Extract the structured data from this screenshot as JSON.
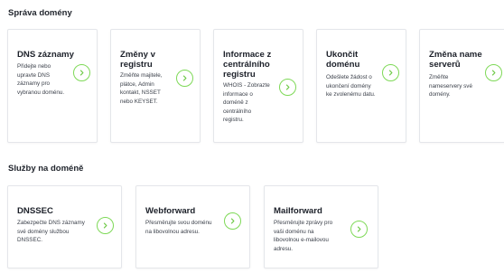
{
  "sections": [
    {
      "title": "Správa domény",
      "cards": [
        {
          "title_lines": [
            "DNS záznamy"
          ],
          "desc_lines": [
            "Přidejte nebo",
            "upravte DNS",
            "záznamy pro",
            "vybranou doménu."
          ]
        },
        {
          "title_lines": [
            "Změny v",
            "registru"
          ],
          "desc_lines": [
            "Změňte majitele,",
            "plátce, Admin",
            "kontakt, NSSET",
            "nebo KEYSET."
          ]
        },
        {
          "title_lines": [
            "Informace z",
            "centrálního",
            "registru"
          ],
          "desc_lines": [
            "WHOIS - Zobrazte",
            "informace o",
            "doméně z",
            "centrálního",
            "registru."
          ]
        },
        {
          "title_lines": [
            "Ukončit",
            "doménu"
          ],
          "desc_lines": [
            "Odešlete žádost o",
            "ukončení domény",
            "ke zvolenému datu."
          ]
        },
        {
          "title_lines": [
            "Změna name",
            "serverů"
          ],
          "desc_lines": [
            "Změňte",
            "nameservery své",
            "domény."
          ]
        }
      ]
    },
    {
      "title": "Služby na doméně",
      "cards": [
        {
          "title_lines": [
            "DNSSEC"
          ],
          "desc_lines": [
            "Zabezpečte DNS záznamy",
            "své domény službou",
            "DNSSEC."
          ]
        },
        {
          "title_lines": [
            "Webforward"
          ],
          "desc_lines": [
            "Přesměrujte svou doménu",
            "na libovolnou adresu."
          ]
        },
        {
          "title_lines": [
            "Mailforward"
          ],
          "desc_lines": [
            "Přesměrujte zprávy pro",
            "vaši doménu na",
            "libovolnou e-mailovou",
            "adresu."
          ]
        }
      ]
    }
  ],
  "icons": {
    "card_action": "chevron-right-icon"
  },
  "colors": {
    "accent": "#7ed957",
    "card_border": "#e4e6ea",
    "title": "#1c2029"
  }
}
